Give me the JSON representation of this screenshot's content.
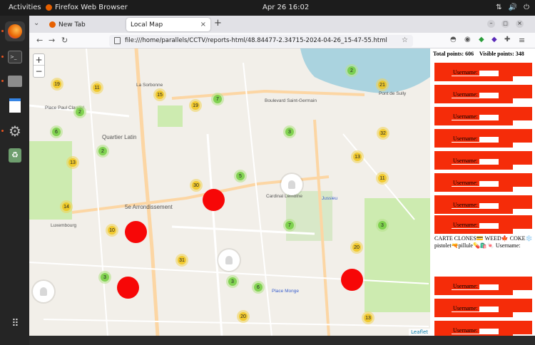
{
  "topbar": {
    "activities": "Activities",
    "app_name": "Firefox Web Browser",
    "clock": "Apr 26  16:02"
  },
  "tabs": [
    {
      "label": "New Tab",
      "active": false
    },
    {
      "label": "Local Map",
      "active": true
    }
  ],
  "url": "file:///home/parallels/CCTV/reports-html/48.84477-2.34715-2024-04-26_15-47-55.html",
  "map": {
    "clusters": [
      {
        "count": "19",
        "color": "yellow"
      },
      {
        "count": "11",
        "color": "yellow"
      },
      {
        "count": "15",
        "color": "yellow"
      },
      {
        "count": "7",
        "color": "green"
      },
      {
        "count": "19",
        "color": "yellow"
      },
      {
        "count": "2",
        "color": "green"
      },
      {
        "count": "21",
        "color": "yellow"
      },
      {
        "count": "2",
        "color": "green"
      },
      {
        "count": "6",
        "color": "green"
      },
      {
        "count": "3",
        "color": "green"
      },
      {
        "count": "32",
        "color": "yellow"
      },
      {
        "count": "2",
        "color": "green"
      },
      {
        "count": "13",
        "color": "yellow"
      },
      {
        "count": "13",
        "color": "yellow"
      },
      {
        "count": "5",
        "color": "green"
      },
      {
        "count": "11",
        "color": "yellow"
      },
      {
        "count": "30",
        "color": "yellow"
      },
      {
        "count": "14",
        "color": "yellow"
      },
      {
        "count": "10",
        "color": "yellow"
      },
      {
        "count": "7",
        "color": "green"
      },
      {
        "count": "3",
        "color": "green"
      },
      {
        "count": "31",
        "color": "yellow"
      },
      {
        "count": "20",
        "color": "yellow"
      },
      {
        "count": "3",
        "color": "green"
      },
      {
        "count": "3",
        "color": "green"
      },
      {
        "count": "6",
        "color": "green"
      },
      {
        "count": "20",
        "color": "yellow"
      },
      {
        "count": "13",
        "color": "yellow"
      }
    ],
    "labels": {
      "quartier_latin": "Quartier Latin",
      "arrondissement": "5e Arrondissement",
      "luxembourg": "Luxembourg",
      "cardinal": "Cardinal Lemoine",
      "monge": "Place Monge",
      "pont_sully": "Pont de Sully",
      "bd_saint_germain": "Boulevard Saint-Germain",
      "place_paul": "Place Paul Claudel",
      "sorbonne": "La Sorbonne",
      "jussieu": "Jussieu"
    },
    "attribution": "Leaflet"
  },
  "panel": {
    "total_points_label": "Total points:",
    "total_points": "606",
    "visible_points_label": "Visible points:",
    "visible_points": "348",
    "username_label": "Username:",
    "ad_text": "CARTE CLONES💳 WEED🍁 COKE❄️ pistolet🔫pillule💊🛍️🍬 Username:"
  }
}
